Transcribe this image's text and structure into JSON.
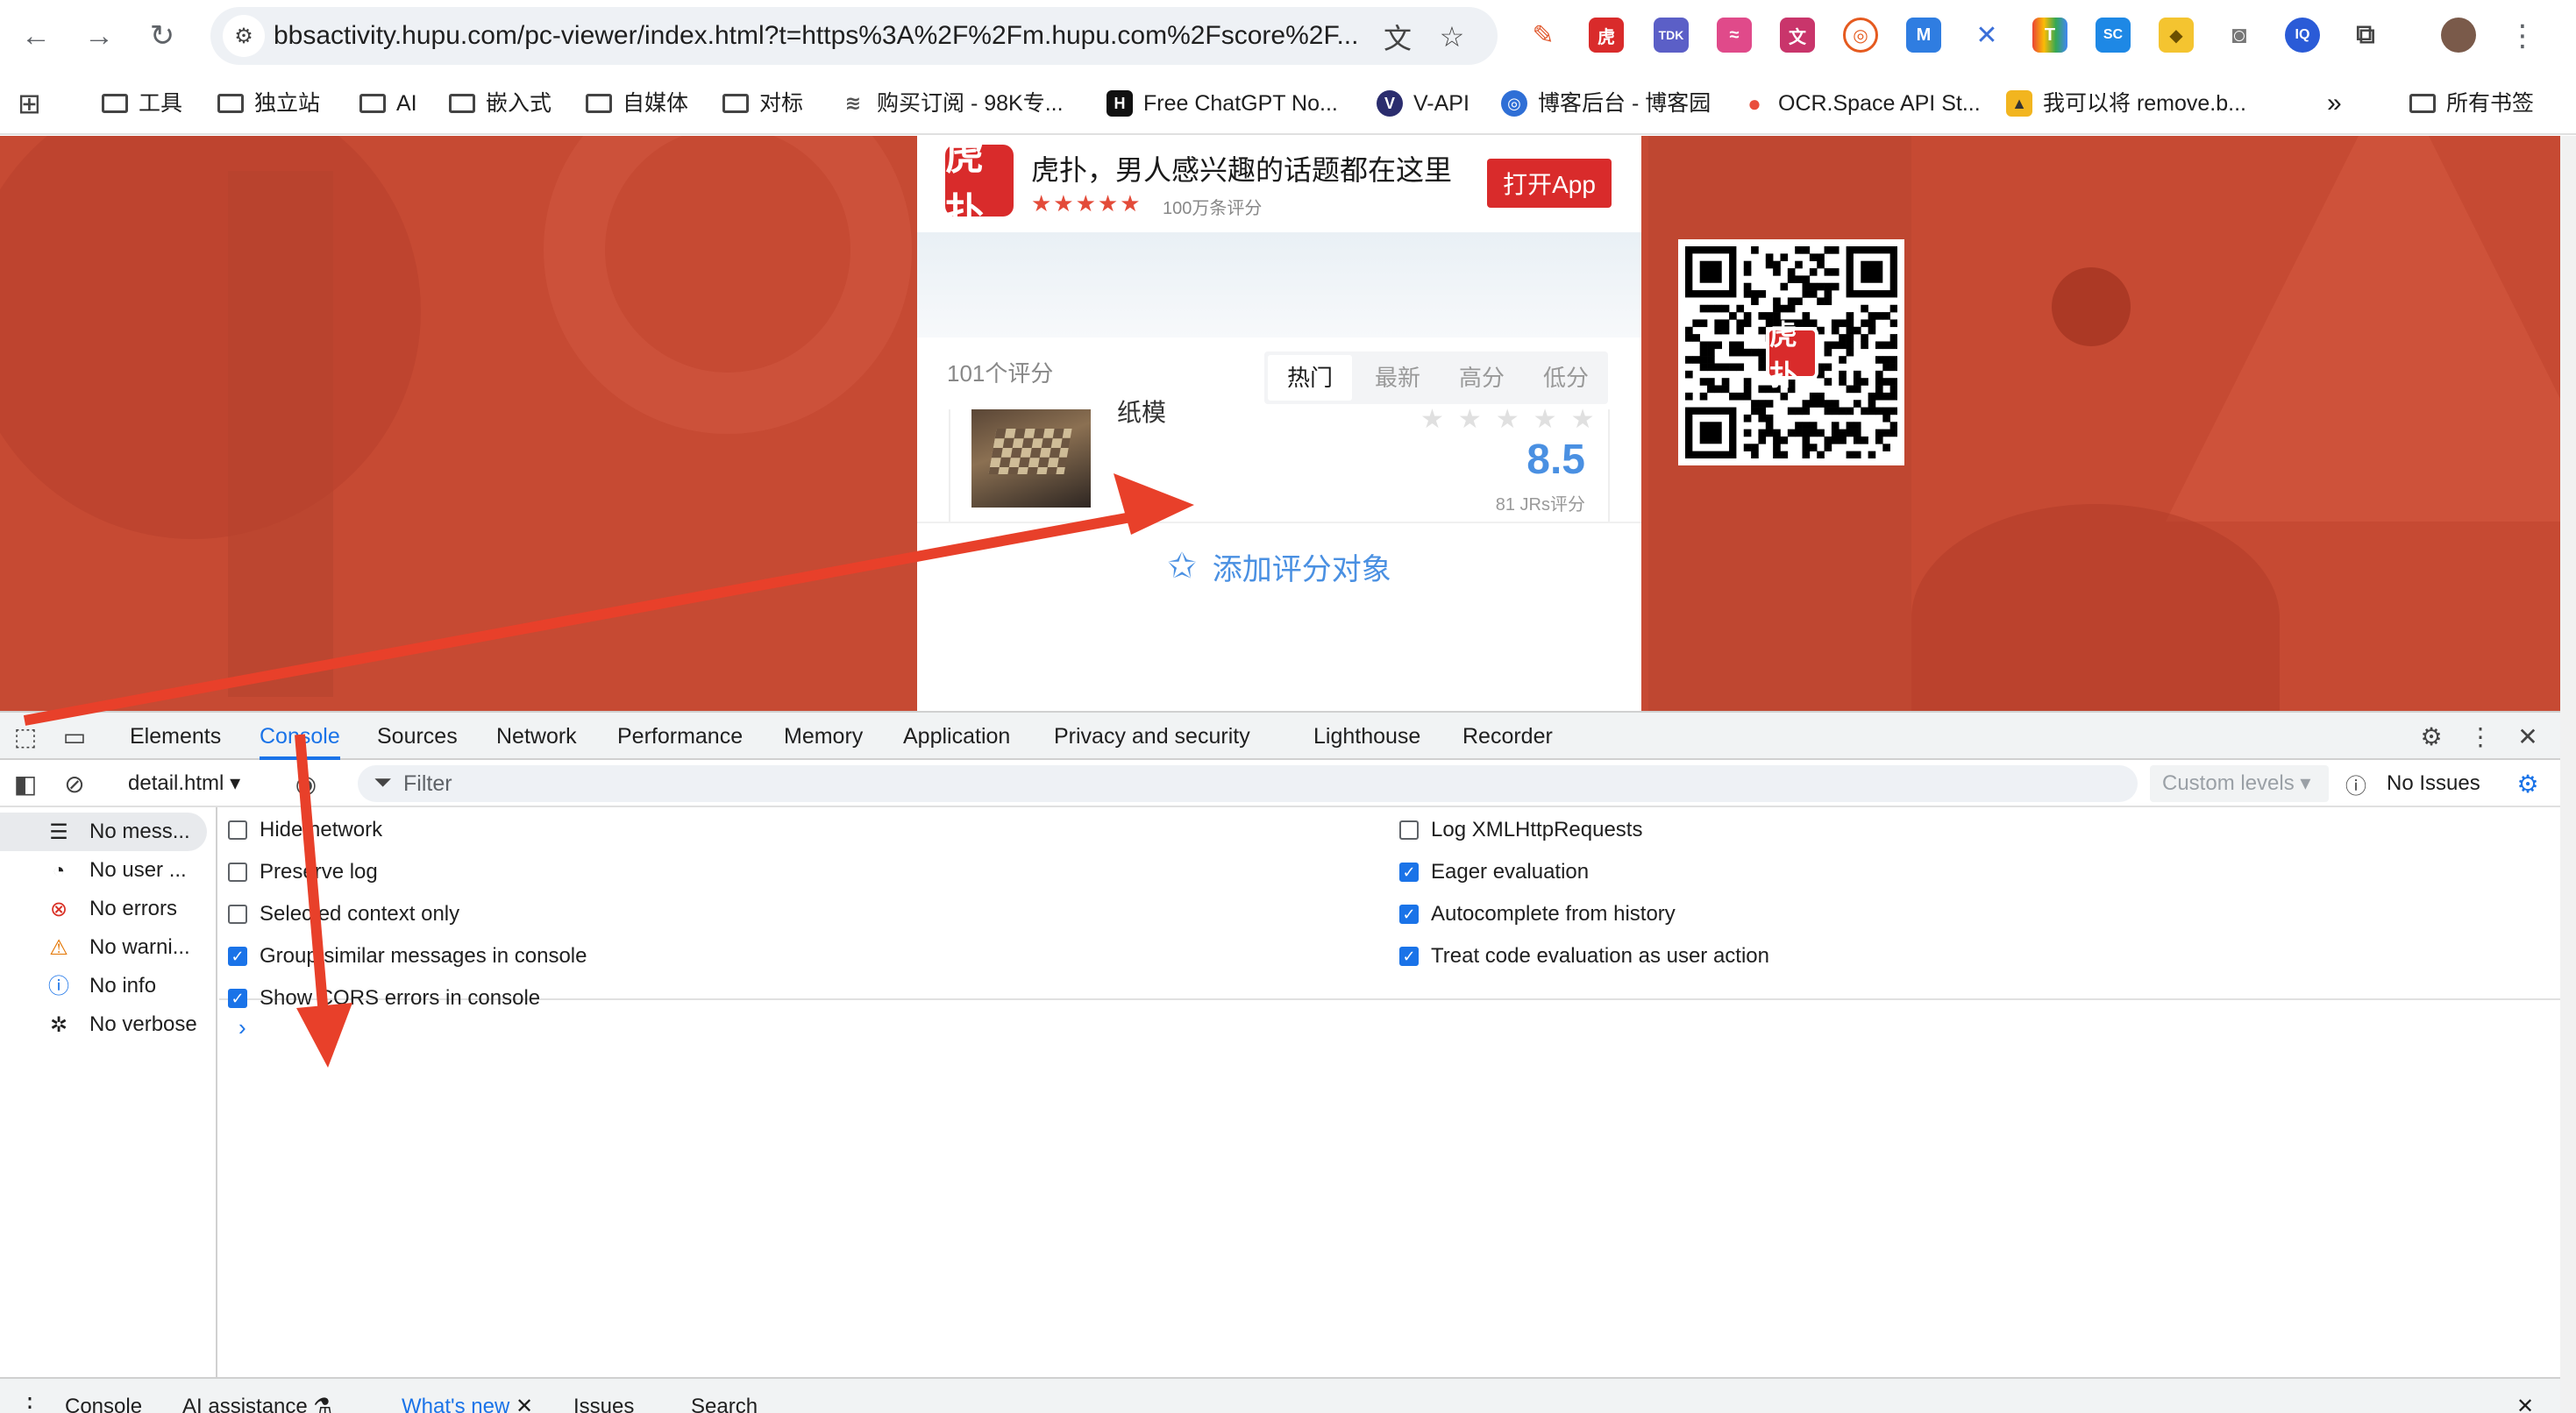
{
  "browser": {
    "url": "bbsactivity.hupu.com/pc-viewer/index.html?t=https%3A%2F%2Fm.hupu.com%2Fscore%2F...",
    "extensions": [
      "pen-icon",
      "hupu-ext",
      "TDK",
      "wave-ext",
      "wenku-ext",
      "target-ext",
      "m-ext",
      "cross-ext",
      "t-ext",
      "SC",
      "pal-ext",
      "camera-ext",
      "qx-ext",
      "puzzle-icon"
    ],
    "bookmarks": [
      {
        "label": "工具"
      },
      {
        "label": "独立站"
      },
      {
        "label": "AI"
      },
      {
        "label": "嵌入式"
      },
      {
        "label": "自媒体"
      },
      {
        "label": "对标"
      },
      {
        "label": "购买订阅 - 98K专..."
      },
      {
        "label": "Free ChatGPT No..."
      },
      {
        "label": "V-API"
      },
      {
        "label": "博客后台 - 博客园"
      },
      {
        "label": "OCR.Space API St..."
      },
      {
        "label": "我可以将 remove.b..."
      }
    ],
    "bookmarks_overflow": "»",
    "all_bookmarks": "所有书签"
  },
  "page": {
    "app_banner": {
      "logo": "虎扑",
      "title": "虎扑，男人感兴趣的话题都在这里",
      "stars": "★★★★★",
      "rating": "100万条评分",
      "open_button": "打开App"
    },
    "rating_count": "101个评分",
    "sort_tabs": [
      "热门",
      "最新",
      "高分",
      "低分"
    ],
    "item": {
      "name": "纸模",
      "stars": "★★★★★",
      "score": "8.5",
      "jrs": "81 JRs评分"
    },
    "add_target": "添加评分对象",
    "qr_logo": "虎扑"
  },
  "devtools": {
    "tabs": [
      "Elements",
      "Console",
      "Sources",
      "Network",
      "Performance",
      "Memory",
      "Application",
      "Privacy and security",
      "Lighthouse",
      "Recorder"
    ],
    "active_tab": "Console",
    "context": "detail.html",
    "filter_placeholder": "Filter",
    "levels": "Custom levels",
    "issues": "No Issues",
    "sidebar": [
      {
        "label": "No mess...",
        "icon": "list-icon"
      },
      {
        "label": "No user ...",
        "icon": "user-icon"
      },
      {
        "label": "No errors",
        "icon": "error-icon"
      },
      {
        "label": "No warni...",
        "icon": "warning-icon"
      },
      {
        "label": "No info",
        "icon": "info-icon"
      },
      {
        "label": "No verbose",
        "icon": "bug-icon"
      }
    ],
    "settings_left": [
      {
        "label": "Hide network",
        "checked": false
      },
      {
        "label": "Preserve log",
        "checked": false
      },
      {
        "label": "Selected context only",
        "checked": false
      },
      {
        "label": "Group similar messages in console",
        "checked": true
      },
      {
        "label": "Show CORS errors in console",
        "checked": true
      }
    ],
    "settings_right": [
      {
        "label": "Log XMLHttpRequests",
        "checked": false
      },
      {
        "label": "Eager evaluation",
        "checked": true
      },
      {
        "label": "Autocomplete from history",
        "checked": true
      },
      {
        "label": "Treat code evaluation as user action",
        "checked": true
      }
    ],
    "prompt": "›",
    "drawer_tabs": [
      "Console",
      "AI assistance",
      "What's new",
      "Issues",
      "Search"
    ]
  },
  "colors": {
    "page_bg": "#c64a33",
    "hupu_red": "#d92b2b",
    "score_blue": "#4a90e2",
    "devtools_accent": "#1a73e8",
    "annotation_arrow": "#e8402a"
  }
}
